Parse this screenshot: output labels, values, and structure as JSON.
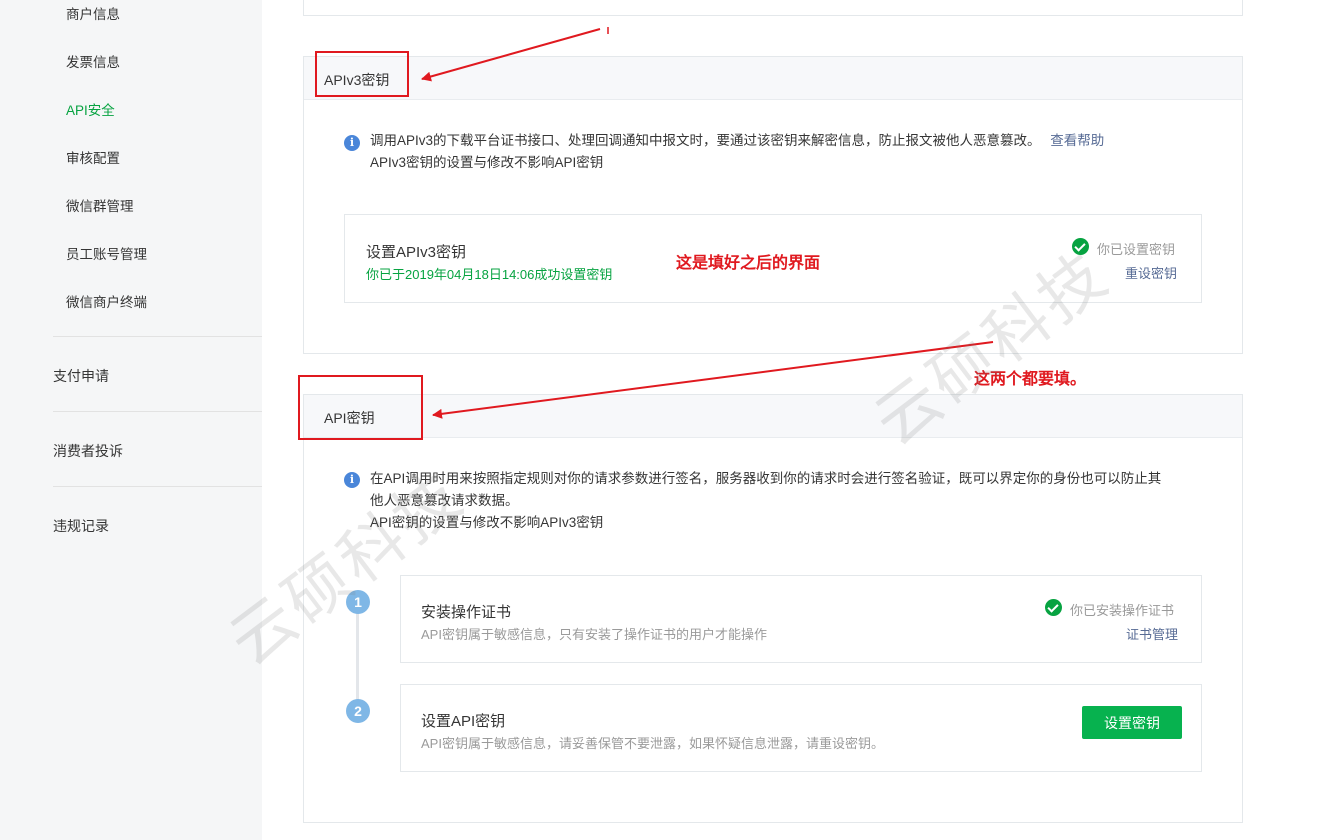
{
  "sidebar": {
    "sub_items": [
      {
        "label": "商户信息"
      },
      {
        "label": "发票信息"
      },
      {
        "label": "API安全"
      },
      {
        "label": "审核配置"
      },
      {
        "label": "微信群管理"
      },
      {
        "label": "员工账号管理"
      },
      {
        "label": "微信商户终端"
      }
    ],
    "main_items": [
      {
        "label": "支付申请"
      },
      {
        "label": "消费者投诉"
      },
      {
        "label": "违规记录"
      }
    ]
  },
  "apiv3": {
    "title": "APIv3密钥",
    "info_line1": "调用APIv3的下载平台证书接口、处理回调通知中报文时，要通过该密钥来解密信息，防止报文被他人恶意篡改。",
    "help_link": "查看帮助",
    "info_line2": "APIv3密钥的设置与修改不影响API密钥",
    "card_title": "设置APIv3密钥",
    "card_sub": "你已于2019年04月18日14:06成功设置密钥",
    "status": "你已设置密钥",
    "reset_link": "重设密钥"
  },
  "api": {
    "title": "API密钥",
    "info_line1": "在API调用时用来按照指定规则对你的请求参数进行签名，服务器收到你的请求时会进行签名验证，既可以界定你的身份也可以防止其",
    "info_line2": "他人恶意篡改请求数据。",
    "info_line3": "API密钥的设置与修改不影响APIv3密钥",
    "steps": [
      {
        "num": "1",
        "title": "安装操作证书",
        "desc": "API密钥属于敏感信息，只有安装了操作证书的用户才能操作",
        "status": "你已安装操作证书",
        "link": "证书管理"
      },
      {
        "num": "2",
        "title": "设置API密钥",
        "desc": "API密钥属于敏感信息，请妥善保管不要泄露，如果怀疑信息泄露，请重设密钥。",
        "button": "设置密钥"
      }
    ]
  },
  "annotations": {
    "after_fill": "这是填好之后的界面",
    "both_required": "这两个都要填。"
  },
  "watermarks": [
    "云硕科技",
    "云硕科技"
  ],
  "colors": {
    "accent_green": "#07a341",
    "link_blue": "#576b95",
    "annotation_red": "#e0191f",
    "info_blue": "#4a86d9",
    "step_blue": "#7fb7e6"
  }
}
